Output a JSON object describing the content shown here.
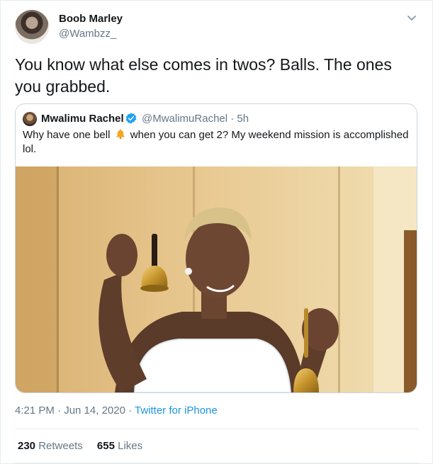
{
  "author": {
    "display_name": "Boob Marley",
    "handle": "@Wambzz_",
    "avatar_icon": "user-avatar"
  },
  "tweet": {
    "text": "You know what else comes in twos? Balls. The ones you grabbed."
  },
  "quoted_tweet": {
    "display_name": "Mwalimu Rachel",
    "handle_time": "@MwalimuRachel · 5h",
    "verified_icon": "verified-badge-icon",
    "text_before_emoji": "Why have one bell",
    "emoji": "bell-emoji",
    "text_after_emoji": "when you can get 2? My weekend mission is accomplished lol.",
    "photo": "photo-woman-holding-two-bells"
  },
  "meta": {
    "time_date": "4:21 PM · Jun 14, 2020 · ",
    "source": "Twitter for iPhone"
  },
  "stats": {
    "retweets_count": "230",
    "retweets_label": "Retweets",
    "likes_count": "655",
    "likes_label": "Likes"
  },
  "colors": {
    "link": "#1b95e0",
    "secondary_text": "#657786",
    "border": "#e6ecf0"
  }
}
